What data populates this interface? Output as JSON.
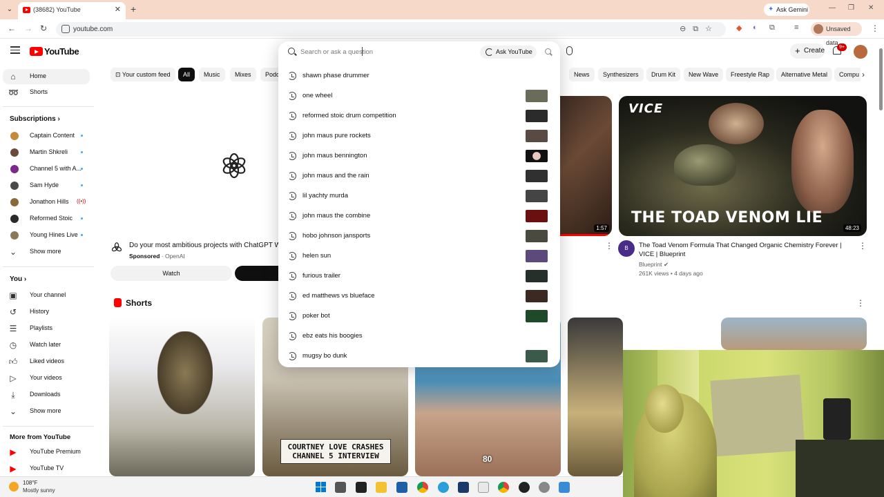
{
  "browser": {
    "tab_title": "(38682) YouTube",
    "url": "youtube.com",
    "ask_gemini": "Ask Gemini",
    "profile_status": "Unsaved data"
  },
  "header": {
    "logo_text": "YouTube",
    "create_label": "Create",
    "notif_count": "9+"
  },
  "search": {
    "placeholder": "Search or ask a question",
    "ask_label": "Ask YouTube",
    "suggestions": [
      {
        "text": "shawn phase drummer",
        "thumb": ""
      },
      {
        "text": "one wheel",
        "thumb": "#6b6b5a"
      },
      {
        "text": "reformed stoic drum competition",
        "thumb": "#2b2b2b"
      },
      {
        "text": "john maus pure rockets",
        "thumb": "#5a4a44"
      },
      {
        "text": "john maus bennington",
        "thumb": "#1a1a1a"
      },
      {
        "text": "john maus and the rain",
        "thumb": "#303030"
      },
      {
        "text": "lil yachty murda",
        "thumb": "#444444"
      },
      {
        "text": "john maus the combine",
        "thumb": "#6b1010"
      },
      {
        "text": "hobo johnson jansports",
        "thumb": "#4a4a3e"
      },
      {
        "text": "helen sun",
        "thumb": "#5b4a7a"
      },
      {
        "text": "furious trailer",
        "thumb": "#26302a"
      },
      {
        "text": "ed matthews vs blueface",
        "thumb": "#3a2a22"
      },
      {
        "text": "poker bot",
        "thumb": "#1e4a2a"
      },
      {
        "text": "ebz eats his boogies",
        "thumb": ""
      },
      {
        "text": "mugsy bo dunk",
        "thumb": "#3a5a4a"
      }
    ]
  },
  "sidebar": {
    "home": "Home",
    "shorts": "Shorts",
    "subscriptions_heading": "Subscriptions",
    "subscriptions": [
      {
        "label": "Captain Content",
        "color": "#c48a3a"
      },
      {
        "label": "Martin Shkreli",
        "color": "#6b4a3a"
      },
      {
        "label": "Channel 5 with A...",
        "color": "#7a2a8a"
      },
      {
        "label": "Sam Hyde",
        "color": "#4a4a4a"
      },
      {
        "label": "Jonathon Hills",
        "color": "#8a6a3a"
      },
      {
        "label": "Reformed Stoic",
        "color": "#2a2a2a"
      },
      {
        "label": "Young Hines Live",
        "color": "#8a7a5a"
      }
    ],
    "live_badge": "((•))",
    "show_more_1": "Show more",
    "you_heading": "You",
    "you_items": [
      {
        "label": "Your channel",
        "icon": "channel"
      },
      {
        "label": "History",
        "icon": "history"
      },
      {
        "label": "Playlists",
        "icon": "playlists"
      },
      {
        "label": "Watch later",
        "icon": "watch-later"
      },
      {
        "label": "Liked videos",
        "icon": "like"
      },
      {
        "label": "Your videos",
        "icon": "videos"
      },
      {
        "label": "Downloads",
        "icon": "download"
      }
    ],
    "show_more_2": "Show more",
    "more_heading": "More from YouTube",
    "more_items": [
      {
        "label": "YouTube Premium"
      },
      {
        "label": "YouTube TV"
      }
    ]
  },
  "chips": {
    "custom_feed": "Your custom feed",
    "all": "All",
    "music": "Music",
    "mixes": "Mixes",
    "podcasts_partial": "Podc",
    "news": "News",
    "synthesizers": "Synthesizers",
    "drum_kit": "Drum Kit",
    "new_wave": "New Wave",
    "freestyle_rap": "Freestyle Rap",
    "alt_metal": "Alternative Metal",
    "computers_partial": "Compu"
  },
  "ad": {
    "title": "Do your most ambitious projects with ChatGPT Wo",
    "sponsored": "Sponsored",
    "advertiser": "OpenAI",
    "watch_label": "Watch"
  },
  "video": {
    "left_duration": "1:57",
    "thumb_brand": "VICE",
    "thumb_text": "THE TOAD VENOM LIE",
    "duration": "48:23",
    "avatar_text": "B",
    "title": "The Toad Venom Formula That Changed Organic Chemistry Forever | VICE | Blueprint",
    "channel": "Blueprint",
    "meta": "261K views • 4 days ago"
  },
  "shorts": {
    "heading": "Shorts",
    "caption": "COURTNEY LOVE CRASHES CHANNEL 5 INTERVIEW",
    "overlay_number": "80"
  },
  "taskbar": {
    "temperature": "108°F",
    "condition": "Mostly sunny"
  }
}
